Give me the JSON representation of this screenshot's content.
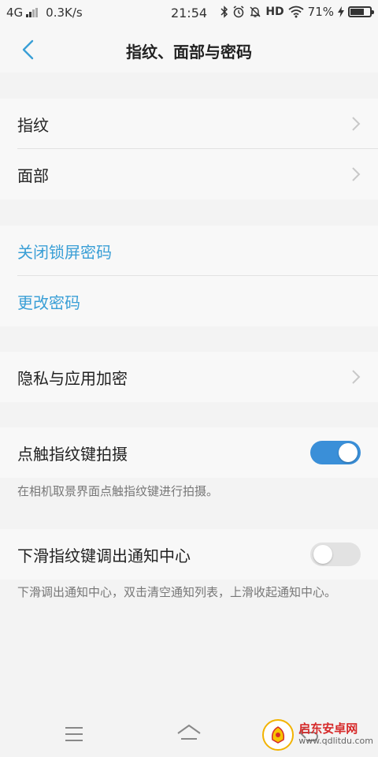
{
  "statusbar": {
    "network": "4G",
    "speed": "0.3K/s",
    "time": "21:54",
    "hd": "HD",
    "battery_percent": "71%",
    "battery_level": 0.71
  },
  "header": {
    "title": "指纹、面部与密码"
  },
  "groups": {
    "biometrics": {
      "fingerprint": "指纹",
      "face": "面部"
    },
    "password": {
      "disable_lock": "关闭锁屏密码",
      "change": "更改密码"
    },
    "privacy": {
      "app_encrypt": "隐私与应用加密"
    },
    "camera": {
      "label": "点触指纹键拍摄",
      "enabled": true,
      "description": "在相机取景界面点触指纹键进行拍摄。"
    },
    "notification": {
      "label": "下滑指纹键调出通知中心",
      "enabled": false,
      "description": "下滑调出通知中心，双击清空通知列表，上滑收起通知中心。"
    }
  },
  "watermark": {
    "name": "启东安卓网",
    "url": "www.qdlitdu.com"
  },
  "colors": {
    "accent": "#3a9fd6",
    "toggle_on": "#3a8fd8",
    "toggle_off": "#e2e2e2"
  }
}
